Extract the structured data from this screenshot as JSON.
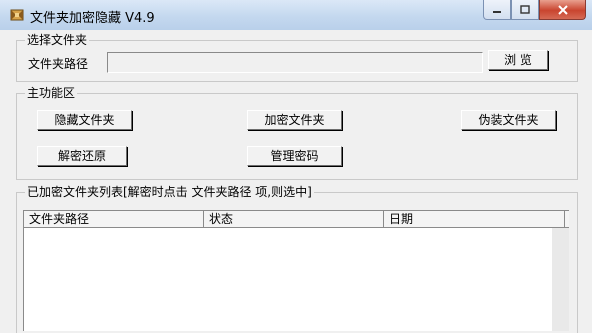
{
  "window": {
    "title": "文件夹加密隐藏 V4.9",
    "icons": {
      "app": "scroll-icon",
      "minimize": "minimize-icon",
      "maximize": "maximize-icon",
      "close": "close-icon"
    }
  },
  "select_folder": {
    "group_title": "选择文件夹",
    "path_label": "文件夹路径",
    "path_value": "",
    "browse_label": "浏 览"
  },
  "main_functions": {
    "group_title": "主功能区",
    "buttons": {
      "hide": "隐藏文件夹",
      "encrypt": "加密文件夹",
      "disguise": "伪装文件夹",
      "decrypt": "解密还原",
      "manage_password": "管理密码"
    }
  },
  "encrypted_list": {
    "group_title": "已加密文件夹列表[解密时点击 文件夹路径 项,则选中]",
    "columns": [
      "文件夹路径",
      "状态",
      "日期"
    ],
    "rows": []
  }
}
